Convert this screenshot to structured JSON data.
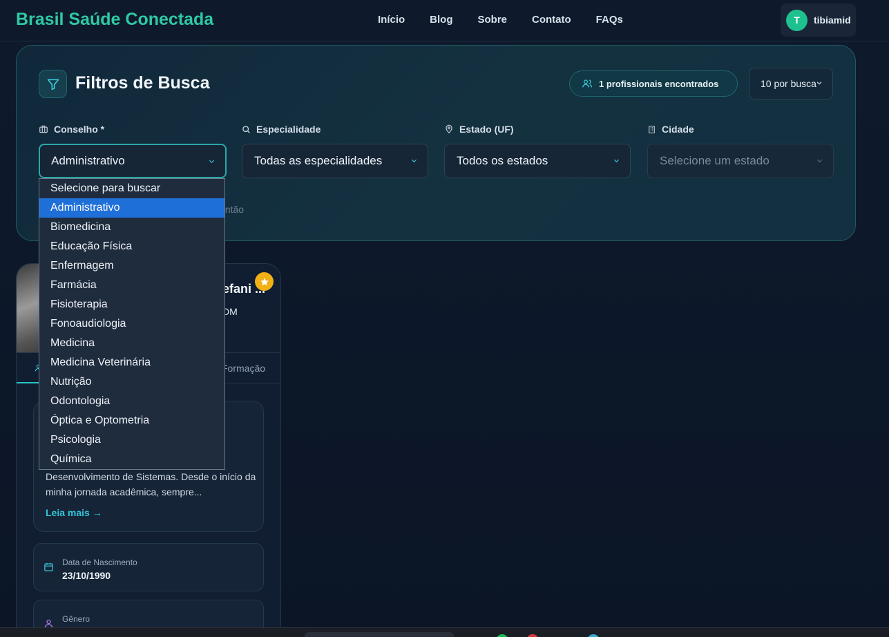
{
  "header": {
    "brand": "Brasil Saúde Conectada",
    "nav": [
      "Início",
      "Blog",
      "Sobre",
      "Contato",
      "FAQs"
    ],
    "user": {
      "initial": "T",
      "name": "tibiamid"
    }
  },
  "filters": {
    "title": "Filtros de Busca",
    "found_label": "1 profissionais encontrados",
    "per_page": "10 por busca",
    "fields": {
      "conselho": {
        "label": "Conselho *",
        "value": "Administrativo"
      },
      "especialidade": {
        "label": "Especialidade",
        "value": "Todas as especialidades"
      },
      "estado": {
        "label": "Estado (UF)",
        "value": "Todos os estados"
      },
      "cidade": {
        "label": "Cidade",
        "placeholder": "Selecione um estado"
      }
    },
    "partial_text": "antão"
  },
  "dropdown": {
    "options": [
      "Selecione para buscar",
      "Administrativo",
      "Biomedicina",
      "Educação Física",
      "Enfermagem",
      "Farmácia",
      "Fisioterapia",
      "Fonoaudiologia",
      "Medicina",
      "Medicina Veterinária",
      "Nutrição",
      "Odontologia",
      "Óptica e Optometria",
      "Psicologia",
      "Química"
    ],
    "selected_index": 1
  },
  "card": {
    "name_partial": "efani ...",
    "reg_partial": "DM",
    "tab_formacao": "Formação",
    "about_text": "Desenvolvimento de Sistemas. Desde o início da minha jornada acadêmica, sempre...",
    "read_more": "Leia mais →",
    "birth_label": "Data de Nascimento",
    "birth_value": "23/10/1990",
    "gender_label": "Gênero"
  },
  "colors": {
    "brand": "#2fc9a3",
    "accent": "#2ac4c8",
    "selected_option": "#1f6fd9",
    "star": "#f2b017"
  }
}
